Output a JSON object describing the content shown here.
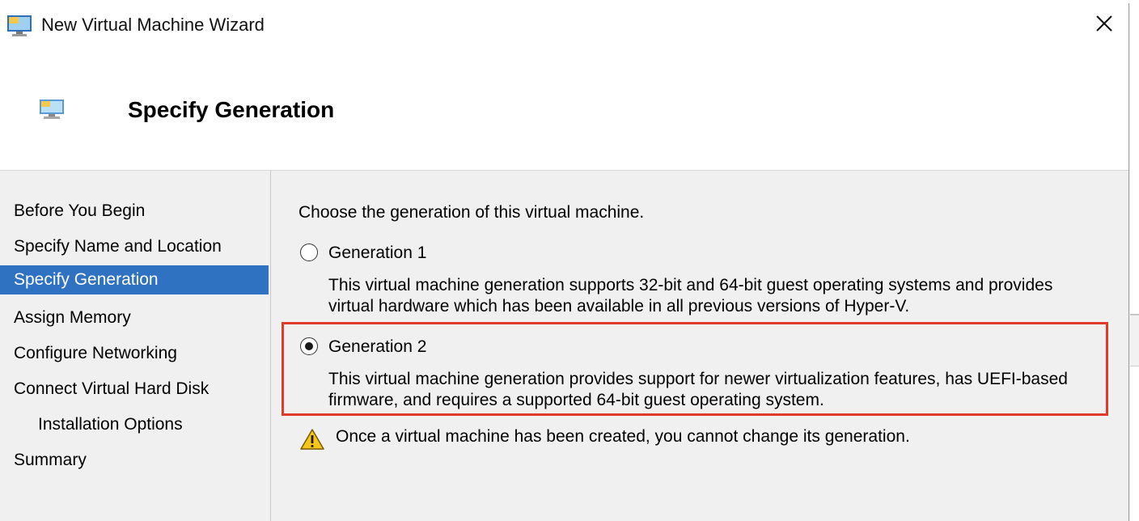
{
  "window": {
    "title": "New Virtual Machine Wizard",
    "close_glyph": "✕"
  },
  "header": {
    "page_title": "Specify Generation"
  },
  "nav": {
    "items": [
      {
        "label": "Before You Begin",
        "selected": false,
        "indent": false
      },
      {
        "label": "Specify Name and Location",
        "selected": false,
        "indent": false
      },
      {
        "label": "Specify Generation",
        "selected": true,
        "indent": false
      },
      {
        "label": "Assign Memory",
        "selected": false,
        "indent": false
      },
      {
        "label": "Configure Networking",
        "selected": false,
        "indent": false
      },
      {
        "label": "Connect Virtual Hard Disk",
        "selected": false,
        "indent": false
      },
      {
        "label": "Installation Options",
        "selected": false,
        "indent": true
      },
      {
        "label": "Summary",
        "selected": false,
        "indent": false
      }
    ]
  },
  "content": {
    "prompt": "Choose the generation of this virtual machine.",
    "options": [
      {
        "label": "Generation 1",
        "checked": false,
        "description_line1": "This virtual machine generation supports 32-bit and 64-bit guest operating systems and provides",
        "description_line2": "virtual hardware which has been available in all previous versions of Hyper-V."
      },
      {
        "label": "Generation 2",
        "checked": true,
        "description_line1": "This virtual machine generation provides support for newer virtualization features, has UEFI-based",
        "description_line2": "firmware, and requires a supported 64-bit guest operating system."
      }
    ],
    "warning": "Once a virtual machine has been created, you cannot change its generation."
  },
  "icons": {
    "app": "monitor-icon",
    "page": "monitor-icon",
    "warning": "warning-triangle-icon",
    "close": "close-icon"
  },
  "colors": {
    "selection": "#3072c2",
    "highlight_border": "#e03a2a",
    "warning_fill": "#f5c518"
  }
}
